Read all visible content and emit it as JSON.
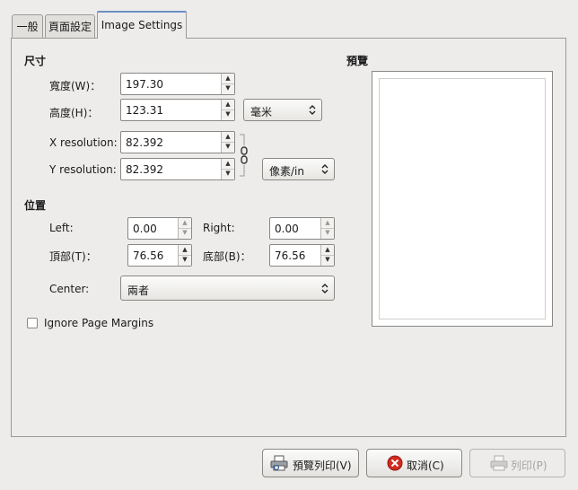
{
  "tabs": [
    {
      "label": "一般"
    },
    {
      "label": "頁面設定"
    },
    {
      "label": "Image Settings"
    }
  ],
  "size_section": {
    "title": "尺寸",
    "width": {
      "label": "寬度(W)：",
      "value": "197.30"
    },
    "height": {
      "label": "高度(H)：",
      "value": "123.31"
    },
    "unit": {
      "selected": "毫米"
    },
    "x_resolution": {
      "label": "X resolution:",
      "value": "82.392"
    },
    "y_resolution": {
      "label": "Y resolution:",
      "value": "82.392"
    },
    "resolution_unit": {
      "selected": "像素/in"
    }
  },
  "position_section": {
    "title": "位置",
    "left": {
      "label": "Left:",
      "value": "0.00"
    },
    "right": {
      "label": "Right:",
      "value": "0.00"
    },
    "top": {
      "label": "頂部(T)：",
      "value": "76.56"
    },
    "bottom": {
      "label": "底部(B)：",
      "value": "76.56"
    },
    "center": {
      "label": "Center:",
      "selected": "兩者"
    }
  },
  "ignore_margins": {
    "label": "Ignore Page Margins",
    "checked": false
  },
  "preview": {
    "title": "預覽"
  },
  "buttons": {
    "print_preview": "預覽列印(V)",
    "cancel": "取消(C)",
    "print": "列印(P)"
  },
  "icons": {
    "spin_up": "▲",
    "spin_down": "▼",
    "combo_arrow": "⌃⌄"
  }
}
